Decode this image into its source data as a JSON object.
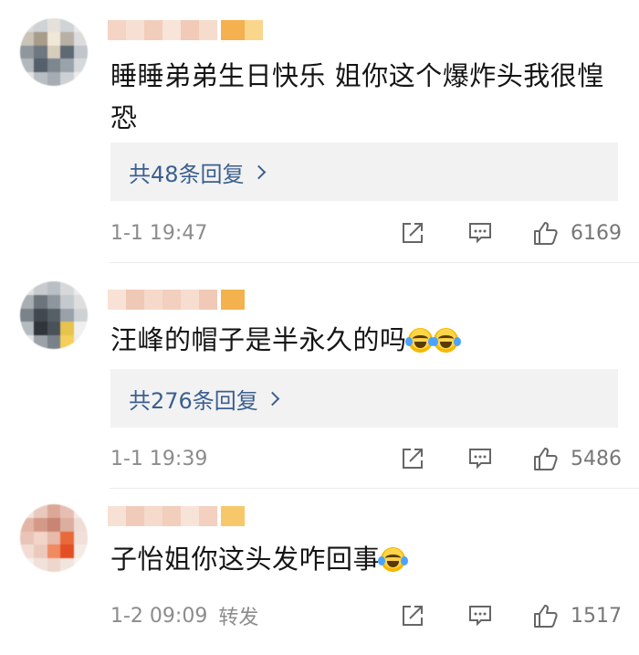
{
  "comments": [
    {
      "text": "睡睡弟弟生日快乐 姐你这个爆炸头我很惶恐",
      "replies_label": "共48条回复",
      "time": "1-1 19:47",
      "forward": "",
      "likes": "6169",
      "emoji_count": 0
    },
    {
      "text": "汪峰的帽子是半永久的吗",
      "replies_label": "共276条回复",
      "time": "1-1 19:39",
      "forward": "",
      "likes": "5486",
      "emoji_count": 2
    },
    {
      "text": "子怡姐你这头发咋回事",
      "replies_label": "",
      "time": "1-2 09:09",
      "forward": "转发",
      "likes": "1517",
      "emoji_count": 1
    }
  ],
  "icons": {
    "share": "share-icon",
    "comment": "comment-icon",
    "like": "thumbs-up-icon",
    "emoji": "laugh-cry-emoji"
  },
  "colors": {
    "link": "#3b5f8f",
    "meta": "#8c8c8c",
    "reply_bg": "#f2f2f2"
  }
}
